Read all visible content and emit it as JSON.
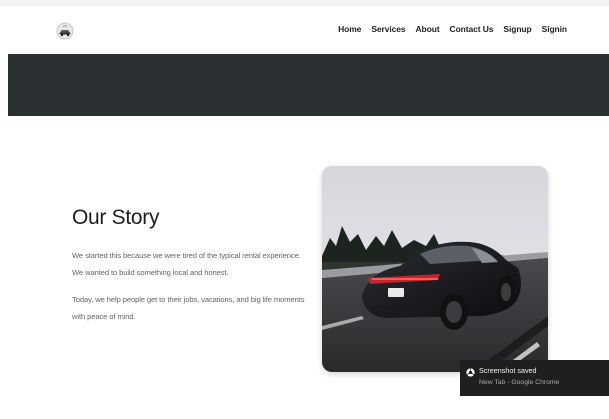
{
  "nav": {
    "logo_icon": "car-logo-icon",
    "links": [
      "Home",
      "Services",
      "About",
      "Contact Us",
      "Signup",
      "Signin"
    ]
  },
  "story": {
    "title": "Our Story",
    "paragraph1": "We started this because we were tired of the typical rental experience. We wanted to build something local and honest.",
    "paragraph2": "Today, we help people get to their jobs, vacations, and big life moments with peace of mind."
  },
  "image": {
    "subject": "black sports car driving on a highway"
  },
  "toast": {
    "icon": "chrome-icon",
    "title": "Screenshot saved",
    "subtitle": "New Tab - Google Chrome"
  },
  "colors": {
    "banner": "#2b3133",
    "toast_bg": "#1f1f1f"
  }
}
